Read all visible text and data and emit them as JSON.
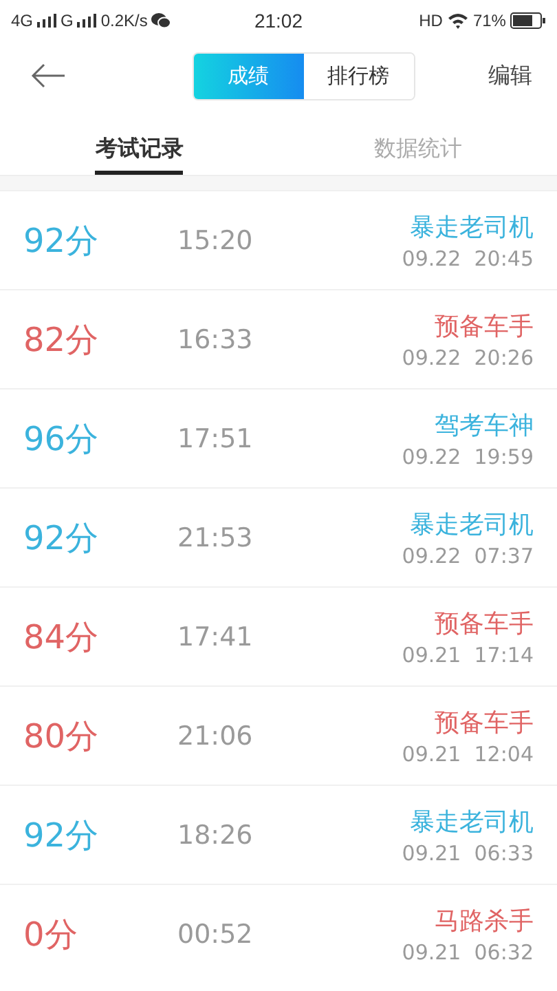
{
  "status_bar": {
    "network_1": "4G",
    "network_2": "G",
    "speed": "0.2K/s",
    "time": "21:02",
    "hd": "HD",
    "battery": "71%"
  },
  "header": {
    "segments": [
      {
        "label": "成绩",
        "selected": true
      },
      {
        "label": "排行榜",
        "selected": false
      }
    ],
    "action": "编辑"
  },
  "tabs": [
    {
      "label": "考试记录",
      "selected": true
    },
    {
      "label": "数据统计",
      "selected": false
    }
  ],
  "records": [
    {
      "score": "92分",
      "duration": "15:20",
      "rank": "暴走老司机",
      "date": "09.22  20:45",
      "color": "#3bb3dd"
    },
    {
      "score": "82分",
      "duration": "16:33",
      "rank": "预备车手",
      "date": "09.22  20:26",
      "color": "#e06464"
    },
    {
      "score": "96分",
      "duration": "17:51",
      "rank": "驾考车神",
      "date": "09.22  19:59",
      "color": "#3bb3dd"
    },
    {
      "score": "92分",
      "duration": "21:53",
      "rank": "暴走老司机",
      "date": "09.22  07:37",
      "color": "#3bb3dd"
    },
    {
      "score": "84分",
      "duration": "17:41",
      "rank": "预备车手",
      "date": "09.21  17:14",
      "color": "#e06464"
    },
    {
      "score": "80分",
      "duration": "21:06",
      "rank": "预备车手",
      "date": "09.21  12:04",
      "color": "#e06464"
    },
    {
      "score": "92分",
      "duration": "18:26",
      "rank": "暴走老司机",
      "date": "09.21  06:33",
      "color": "#3bb3dd"
    },
    {
      "score": "0分",
      "duration": "00:52",
      "rank": "马路杀手",
      "date": "09.21  06:32",
      "color": "#e06464"
    }
  ]
}
